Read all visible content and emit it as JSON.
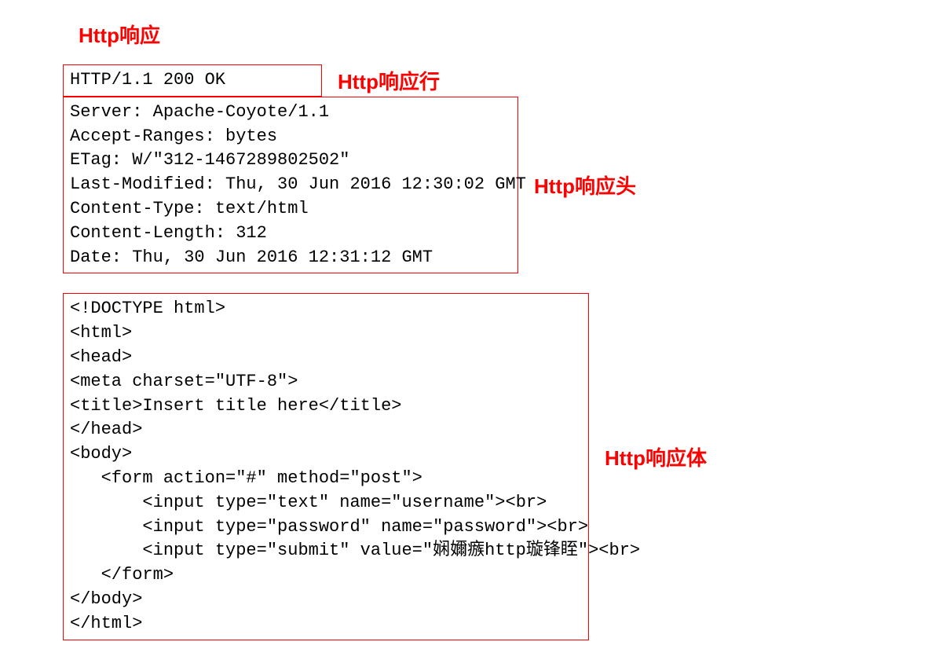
{
  "title": "Http响应",
  "status_line": {
    "content": "HTTP/1.1 200 OK",
    "label": "Http响应行"
  },
  "headers": {
    "label": "Http响应头",
    "lines": [
      "Server: Apache-Coyote/1.1",
      "Accept-Ranges: bytes",
      "ETag: W/\"312-1467289802502\"",
      "Last-Modified: Thu, 30 Jun 2016 12:30:02 GMT",
      "Content-Type: text/html",
      "Content-Length: 312",
      "Date: Thu, 30 Jun 2016 12:31:12 GMT"
    ]
  },
  "body": {
    "label": "Http响应体",
    "lines": [
      "<!DOCTYPE html>",
      "<html>",
      "<head>",
      "<meta charset=\"UTF-8\">",
      "<title>Insert title here</title>",
      "</head>",
      "<body>",
      "   <form action=\"#\" method=\"post\">",
      "       <input type=\"text\" name=\"username\"><br>",
      "       <input type=\"password\" name=\"password\"><br>",
      "       <input type=\"submit\" value=\"娴嬭瘯http璇锋眰\"><br>",
      "   </form>",
      "</body>",
      "</html>"
    ]
  }
}
